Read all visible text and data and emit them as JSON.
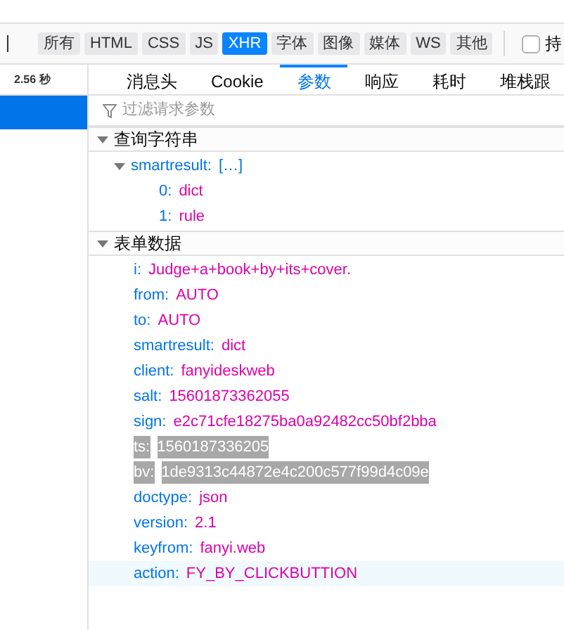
{
  "filters": [
    {
      "label": "所有",
      "selected": false
    },
    {
      "label": "HTML",
      "selected": false
    },
    {
      "label": "CSS",
      "selected": false
    },
    {
      "label": "JS",
      "selected": false
    },
    {
      "label": "XHR",
      "selected": true
    },
    {
      "label": "字体",
      "selected": false
    },
    {
      "label": "图像",
      "selected": false
    },
    {
      "label": "媒体",
      "selected": false
    },
    {
      "label": "WS",
      "selected": false
    },
    {
      "label": "其他",
      "selected": false
    }
  ],
  "persist": {
    "label": "持",
    "checked": false
  },
  "timeline": {
    "time": "2.56 秒"
  },
  "tabs": [
    {
      "label": "消息头",
      "selected": false
    },
    {
      "label": "Cookie",
      "selected": false
    },
    {
      "label": "参数",
      "selected": true
    },
    {
      "label": "响应",
      "selected": false
    },
    {
      "label": "耗时",
      "selected": false
    },
    {
      "label": "堆栈跟",
      "selected": false
    }
  ],
  "filter_field": {
    "placeholder": "过滤请求参数"
  },
  "sections": [
    {
      "title": "查询字符串",
      "expanded": true,
      "rows": [
        {
          "key": "smartresult:",
          "value": "[…]",
          "expanded": true,
          "children": [
            {
              "key": "0:",
              "value": "dict"
            },
            {
              "key": "1:",
              "value": "rule"
            }
          ]
        }
      ]
    },
    {
      "title": "表单数据",
      "expanded": true,
      "rows": [
        {
          "key": "i:",
          "value": "Judge+a+book+by+its+cover.",
          "highlighted": false,
          "hovered": false
        },
        {
          "key": "from:",
          "value": "AUTO",
          "highlighted": false,
          "hovered": false
        },
        {
          "key": "to:",
          "value": "AUTO",
          "highlighted": false,
          "hovered": false
        },
        {
          "key": "smartresult:",
          "value": "dict",
          "highlighted": false,
          "hovered": false
        },
        {
          "key": "client:",
          "value": "fanyideskweb",
          "highlighted": false,
          "hovered": false
        },
        {
          "key": "salt:",
          "value": "15601873362055",
          "highlighted": false,
          "hovered": false
        },
        {
          "key": "sign:",
          "value": "e2c71cfe18275ba0a92482cc50bf2bba",
          "highlighted": false,
          "hovered": false
        },
        {
          "key": "ts:",
          "value": "1560187336205",
          "highlighted": true,
          "hovered": false
        },
        {
          "key": "bv:",
          "value": "1de9313c44872e4c200c577f99d4c09e",
          "highlighted": true,
          "hovered": false
        },
        {
          "key": "doctype:",
          "value": "json",
          "highlighted": false,
          "hovered": false
        },
        {
          "key": "version:",
          "value": "2.1",
          "highlighted": false,
          "hovered": false
        },
        {
          "key": "keyfrom:",
          "value": "fanyi.web",
          "highlighted": false,
          "hovered": false
        },
        {
          "key": "action:",
          "value": "FY_BY_CLICKBUTTION",
          "highlighted": false,
          "hovered": true
        }
      ]
    }
  ]
}
